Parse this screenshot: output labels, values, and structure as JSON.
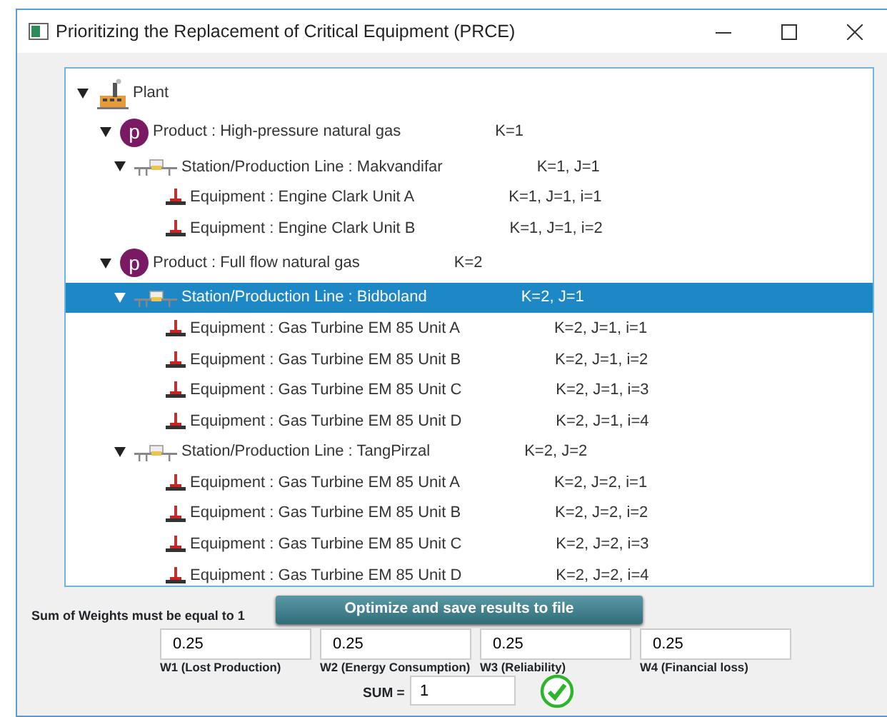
{
  "window": {
    "title": "Prioritizing the Replacement of Critical Equipment (PRCE)"
  },
  "tree": [
    {
      "kind": "plant",
      "label": "Plant",
      "expanded": true,
      "selected": false,
      "children": [
        {
          "kind": "product",
          "badge": "p",
          "label": "Product : High-pressure natural gas",
          "key": "K=1",
          "expanded": true,
          "selected": false,
          "children": [
            {
              "kind": "station",
              "label": "Station/Production Line : Makvandifar",
              "key": "K=1, J=1",
              "expanded": true,
              "selected": false,
              "children": [
                {
                  "kind": "equipment",
                  "label": "Equipment : Engine Clark Unit A",
                  "key": "K=1, J=1, i=1",
                  "selected": false
                },
                {
                  "kind": "equipment",
                  "label": "Equipment : Engine Clark Unit B",
                  "key": "K=1, J=1, i=2",
                  "selected": false
                }
              ]
            }
          ]
        },
        {
          "kind": "product",
          "badge": "p",
          "label": "Product : Full flow natural gas",
          "key": "K=2",
          "expanded": true,
          "selected": false,
          "children": [
            {
              "kind": "station",
              "label": "Station/Production Line : Bidboland",
              "key": "K=2, J=1",
              "expanded": true,
              "selected": true,
              "children": [
                {
                  "kind": "equipment",
                  "label": "Equipment : Gas Turbine EM 85 Unit A",
                  "key": "K=2, J=1, i=1",
                  "selected": false
                },
                {
                  "kind": "equipment",
                  "label": "Equipment : Gas Turbine EM 85 Unit B",
                  "key": "K=2, J=1, i=2",
                  "selected": false
                },
                {
                  "kind": "equipment",
                  "label": "Equipment : Gas Turbine EM 85 Unit C",
                  "key": "K=2, J=1, i=3",
                  "selected": false
                },
                {
                  "kind": "equipment",
                  "label": "Equipment : Gas Turbine EM 85 Unit D",
                  "key": "K=2, J=1, i=4",
                  "selected": false
                }
              ]
            },
            {
              "kind": "station",
              "label": "Station/Production Line : TangPirzal",
              "key": "K=2, J=2",
              "expanded": true,
              "selected": false,
              "children": [
                {
                  "kind": "equipment",
                  "label": "Equipment : Gas Turbine EM 85 Unit A",
                  "key": "K=2, J=2, i=1",
                  "selected": false
                },
                {
                  "kind": "equipment",
                  "label": "Equipment : Gas Turbine EM 85 Unit B",
                  "key": "K=2, J=2, i=2",
                  "selected": false
                },
                {
                  "kind": "equipment",
                  "label": "Equipment : Gas Turbine EM 85 Unit C",
                  "key": "K=2, J=2, i=3",
                  "selected": false
                },
                {
                  "kind": "equipment",
                  "label": "Equipment : Gas Turbine EM 85 Unit D",
                  "key": "K=2, J=2, i=4",
                  "selected": false
                }
              ]
            }
          ]
        }
      ]
    }
  ],
  "note": "Sum of Weights must be equal to 1",
  "optimize_button": "Optimize and save results to file",
  "weights": [
    {
      "value": "0.25",
      "label": "W1 (Lost Production)"
    },
    {
      "value": "0.25",
      "label": "W2 (Energy Consumption)"
    },
    {
      "value": "0.25",
      "label": "W3 (Reliability)"
    },
    {
      "value": "0.25",
      "label": "W4 (Financial loss)"
    }
  ],
  "sum": {
    "label": "SUM =",
    "value": "1",
    "valid": true
  }
}
